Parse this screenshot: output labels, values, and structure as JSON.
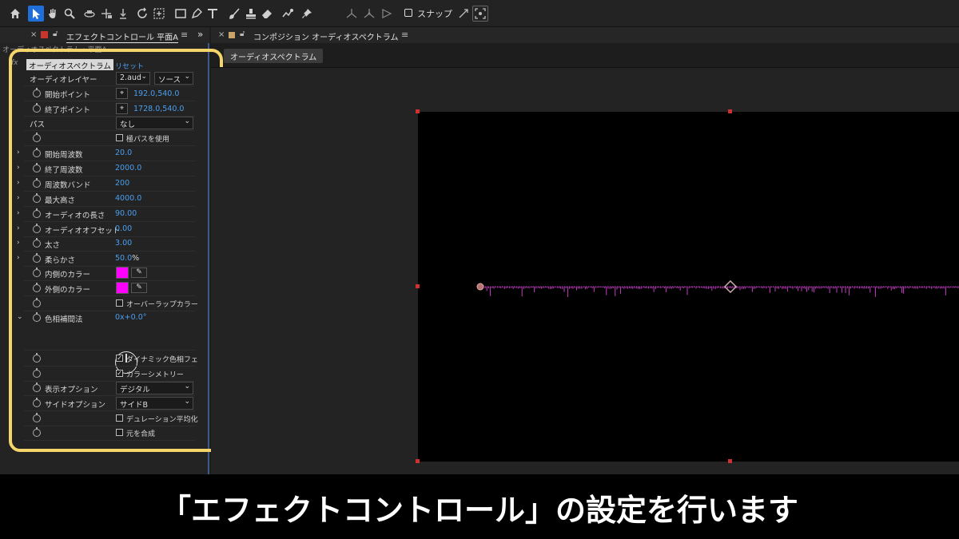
{
  "toolbar": {
    "tools": [
      "home-icon",
      "selection-tool-icon",
      "hand-tool-icon",
      "zoom-tool-icon",
      "orbit-camera-icon",
      "pan-camera-icon",
      "dolly-camera-icon",
      "rotate-tool-icon",
      "pan-behind-icon",
      "rectangle-tool-icon",
      "pen-tool-icon",
      "type-tool-icon",
      "brush-tool-icon",
      "clone-stamp-icon",
      "eraser-tool-icon",
      "roto-brush-icon",
      "puppet-pin-icon"
    ],
    "snap_label": "スナップ"
  },
  "effect_panel": {
    "title": "エフェクトコントロール 平面A",
    "layer_path": "オーディオスペクトラム・平面A",
    "fx_label": "fx",
    "effect_name": "オーディオスペクトラム",
    "reset": "リセット",
    "audio_layer": {
      "label": "オーディオレイヤー",
      "value": "2.aud",
      "source": "ソース"
    },
    "start_point": {
      "label": "開始ポイント",
      "value": "192.0,540.0"
    },
    "end_point": {
      "label": "終了ポイント",
      "value": "1728.0,540.0"
    },
    "path": {
      "label": "パス",
      "value": "なし"
    },
    "use_polar": {
      "label": "極パスを使用",
      "checked": false
    },
    "start_freq": {
      "label": "開始周波数",
      "value": "20.0"
    },
    "end_freq": {
      "label": "終了周波数",
      "value": "2000.0"
    },
    "freq_bands": {
      "label": "周波数バンド",
      "value": "200"
    },
    "max_height": {
      "label": "最大高さ",
      "value": "4000.0"
    },
    "audio_duration": {
      "label": "オーディオの長さ",
      "value": "90.00"
    },
    "audio_offset": {
      "label": "オーディオオフセット",
      "value": "0.00"
    },
    "thickness": {
      "label": "太さ",
      "value": "3.00"
    },
    "softness": {
      "label": "柔らかさ",
      "value": "50.0",
      "unit": "%"
    },
    "inside_color": {
      "label": "内側のカラー",
      "color": "#ff00ff"
    },
    "outside_color": {
      "label": "外側のカラー",
      "color": "#ff00ff"
    },
    "blend_overlap": {
      "label": "オーバーラップカラー",
      "checked": false
    },
    "hue_interp": {
      "label": "色相補間法",
      "value": "0x+0.0°"
    },
    "dynamic_hue": {
      "label": "ダイナミック色相フェ",
      "checked": true
    },
    "color_symmetry": {
      "label": "カラーシメトリー",
      "checked": true
    },
    "display_options": {
      "label": "表示オプション",
      "value": "デジタル"
    },
    "side_options": {
      "label": "サイドオプション",
      "value": "サイドB"
    },
    "duration_avg": {
      "label": "デュレーション平均化",
      "checked": false
    },
    "composite_original": {
      "label": "元を合成",
      "checked": false
    }
  },
  "comp_panel": {
    "title": "コンポジション オーディオスペクトラム",
    "tab": "オーディオスペクトラム",
    "waveform_color": "#c83cc8"
  },
  "subtitle": "「エフェクトコントロール」の設定を行います"
}
